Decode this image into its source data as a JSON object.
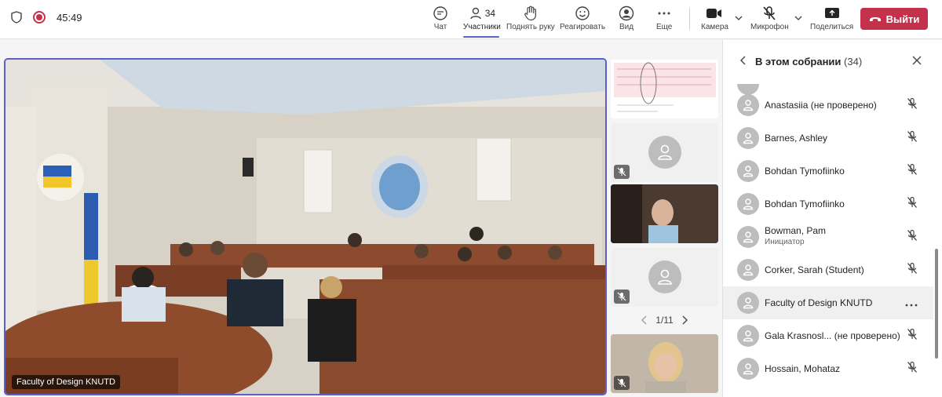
{
  "topbar": {
    "timer": "45:49",
    "chat_label": "Чат",
    "participants_label": "Участники",
    "participants_count": "34",
    "raise_hand_label": "Поднять руку",
    "react_label": "Реагировать",
    "view_label": "Вид",
    "more_label": "Еще",
    "camera_label": "Камера",
    "mic_label": "Микрофон",
    "share_label": "Поделиться",
    "leave_label": "Выйти"
  },
  "stage": {
    "speaker_name": "Faculty of Design KNUTD"
  },
  "thumbnails": {
    "pager": "1/11"
  },
  "panel": {
    "title": "В этом собрании",
    "count": "(34)",
    "participants": [
      {
        "name": "Anastasiia (не проверено)",
        "role": ""
      },
      {
        "name": "Barnes, Ashley",
        "role": ""
      },
      {
        "name": "Bohdan Tymofiinko",
        "role": ""
      },
      {
        "name": "Bohdan Tymofiinko",
        "role": ""
      },
      {
        "name": "Bowman, Pam",
        "role": "Инициатор"
      },
      {
        "name": "Corker, Sarah (Student)",
        "role": ""
      },
      {
        "name": "Faculty of Design KNUTD",
        "role": ""
      },
      {
        "name": "Gala Krasnosl... (не проверено)",
        "role": ""
      },
      {
        "name": "Hossain, Mohataz",
        "role": ""
      }
    ]
  },
  "colors": {
    "accent": "#5b5fc7",
    "leave": "#c4314b",
    "recording": "#c4314b"
  }
}
